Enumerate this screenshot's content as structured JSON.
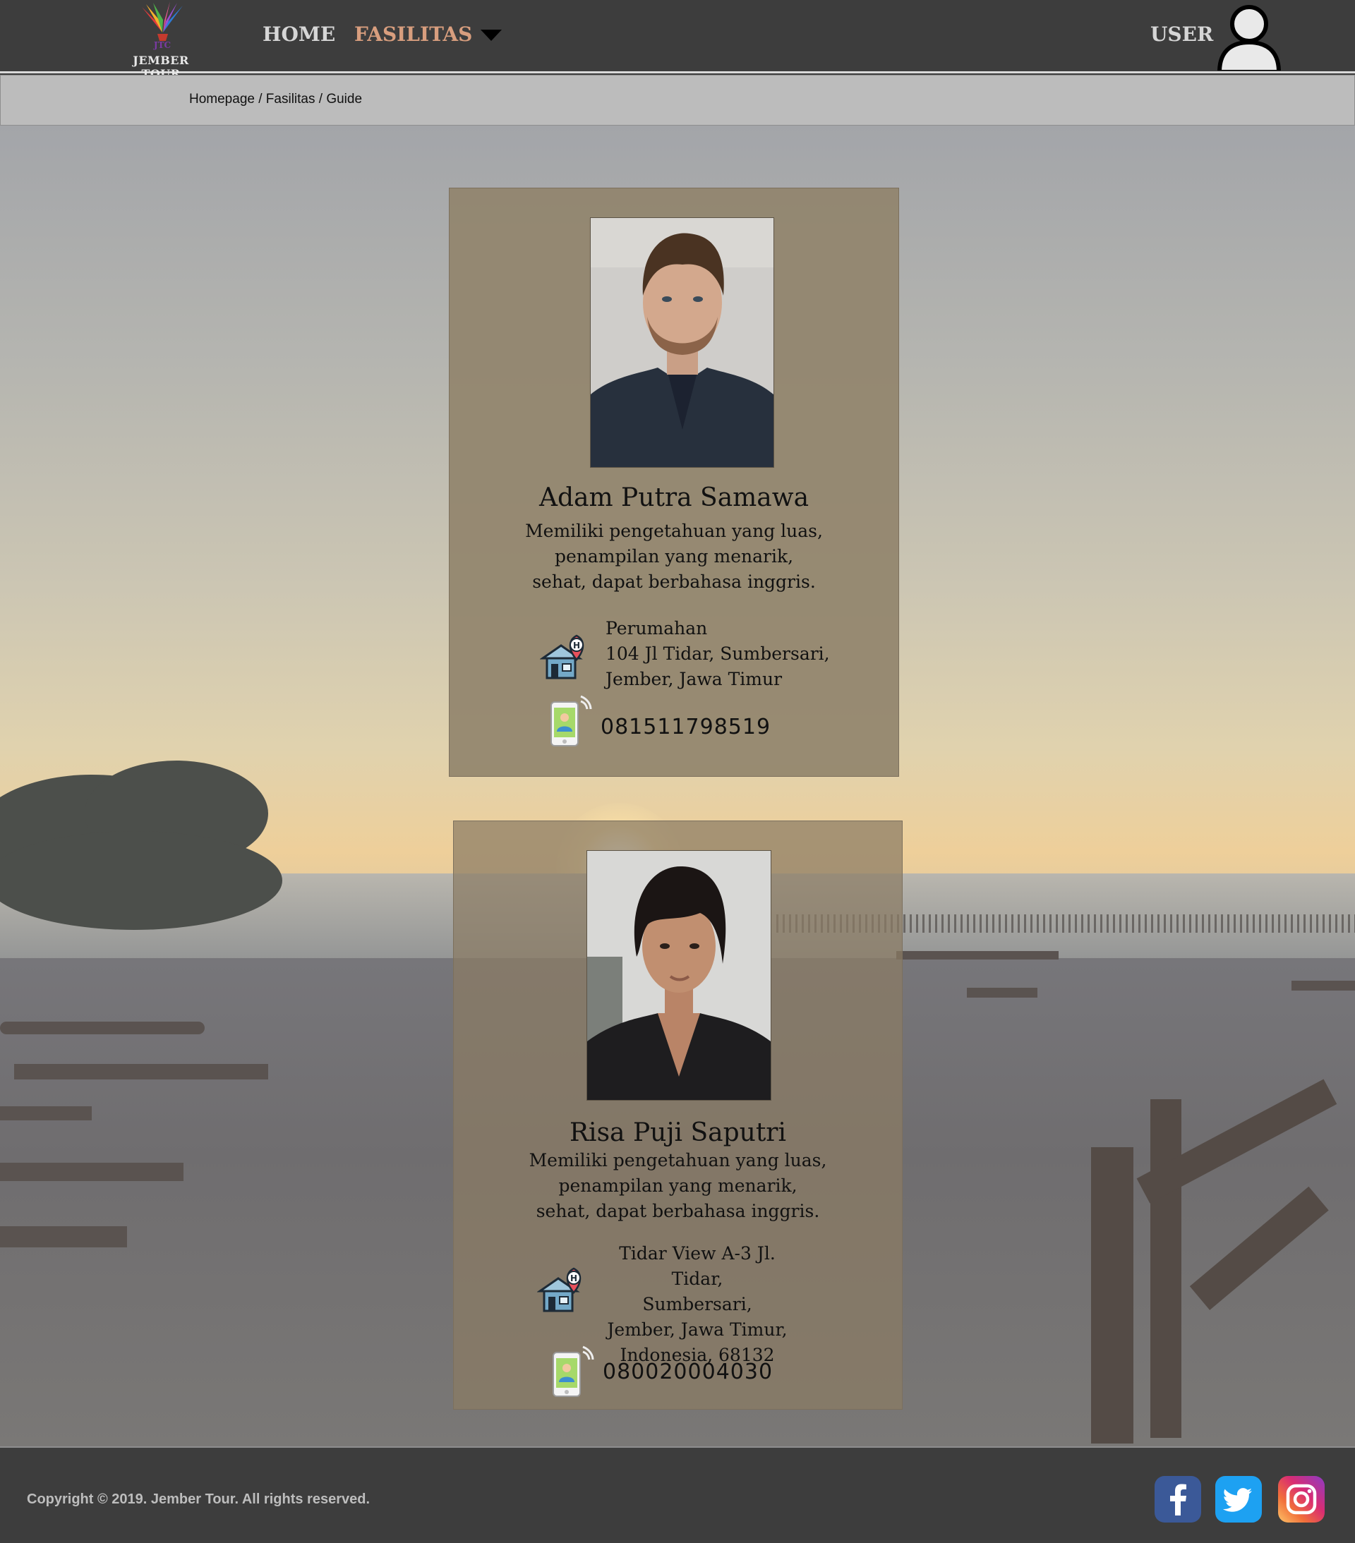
{
  "brand": {
    "logo_text": "JEMBER TOUR",
    "logo_emblem_text": "JTC"
  },
  "nav": {
    "home": "HOME",
    "fasilitas": "FASILITAS",
    "user": "USER"
  },
  "breadcrumb": {
    "items": [
      "Homepage",
      "Fasilitas",
      "Guide"
    ],
    "separator": " / "
  },
  "guides": [
    {
      "name": "Adam Putra Samawa",
      "description": [
        "Memiliki pengetahuan yang luas,",
        "penampilan yang menarik,",
        "sehat, dapat berbahasa inggris."
      ],
      "address": [
        "Perumahan",
        "104 Jl Tidar, Sumbersari,",
        "Jember, Jawa Timur"
      ],
      "phone": "081511798519"
    },
    {
      "name": "Risa Puji Saputri",
      "description": [
        "Memiliki pengetahuan yang luas,",
        "penampilan yang menarik,",
        "sehat, dapat berbahasa inggris."
      ],
      "address": [
        "Tidar View A-3 Jl. Tidar,",
        "Sumbersari,",
        "Jember, Jawa Timur,",
        "Indonesia, 68132"
      ],
      "phone": "080020004030"
    }
  ],
  "footer": {
    "copyright": "Copyright © 2019. Jember Tour. All rights reserved."
  },
  "social": [
    "facebook-icon",
    "twitter-icon",
    "instagram-icon"
  ],
  "colors": {
    "header_bg": "#3d3d3d",
    "breadcrumb_bg": "#bcbcbc",
    "active_nav": "#d89e7e",
    "card_bg": "#91846c"
  }
}
